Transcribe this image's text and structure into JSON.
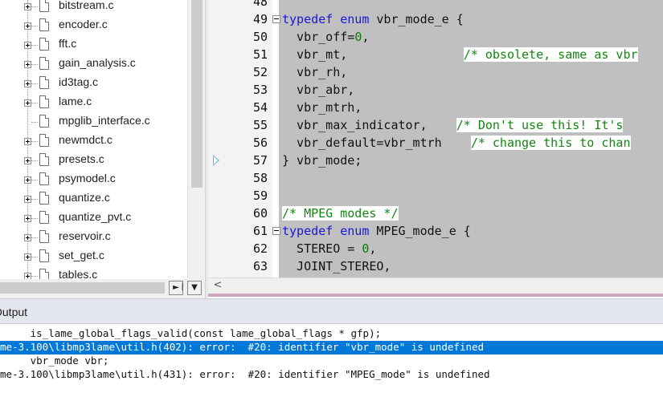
{
  "file_tree": {
    "items": [
      {
        "label": "bitstream.c",
        "expandable": true
      },
      {
        "label": "encoder.c",
        "expandable": true
      },
      {
        "label": "fft.c",
        "expandable": true
      },
      {
        "label": "gain_analysis.c",
        "expandable": true
      },
      {
        "label": "id3tag.c",
        "expandable": true
      },
      {
        "label": "lame.c",
        "expandable": true
      },
      {
        "label": "mpglib_interface.c",
        "expandable": false
      },
      {
        "label": "newmdct.c",
        "expandable": true
      },
      {
        "label": "presets.c",
        "expandable": true
      },
      {
        "label": "psymodel.c",
        "expandable": true
      },
      {
        "label": "quantize.c",
        "expandable": true
      },
      {
        "label": "quantize_pvt.c",
        "expandable": true
      },
      {
        "label": "reservoir.c",
        "expandable": true
      },
      {
        "label": "set_get.c",
        "expandable": true
      },
      {
        "label": "tables.c",
        "expandable": true
      }
    ],
    "scroll_right_arrow": "►",
    "scroll_split": "|",
    "scroll_down_arrow": "▼"
  },
  "editor": {
    "scroll_left_arrow": "<",
    "lines": [
      {
        "num": "48",
        "text": ""
      },
      {
        "num": "49",
        "text": "typedef enum vbr_mode_e {"
      },
      {
        "num": "50",
        "text": "  vbr_off=0,"
      },
      {
        "num": "51",
        "text": "  vbr_mt,                /* obsolete, same as vbr"
      },
      {
        "num": "52",
        "text": "  vbr_rh,"
      },
      {
        "num": "53",
        "text": "  vbr_abr,"
      },
      {
        "num": "54",
        "text": "  vbr_mtrh,"
      },
      {
        "num": "55",
        "text": "  vbr_max_indicator,    /* Don't use this! It's"
      },
      {
        "num": "56",
        "text": "  vbr_default=vbr_mtrh    /* change this to chan"
      },
      {
        "num": "57",
        "text": "} vbr_mode;"
      },
      {
        "num": "58",
        "text": ""
      },
      {
        "num": "59",
        "text": ""
      },
      {
        "num": "60",
        "text": "/* MPEG modes */"
      },
      {
        "num": "61",
        "text": "typedef enum MPEG_mode_e {"
      },
      {
        "num": "62",
        "text": "  STEREO = 0,"
      },
      {
        "num": "63",
        "text": "  JOINT_STEREO,"
      }
    ]
  },
  "output": {
    "title": "Output",
    "lines": [
      {
        "text": "     is_lame_global_flags_valid(const lame_global_flags * gfp);",
        "selected": false
      },
      {
        "text": "me-3.100\\libmp3lame\\util.h(402): error:  #20: identifier \"vbr_mode\" is undefined",
        "selected": true
      },
      {
        "text": "     vbr_mode vbr;",
        "selected": false
      },
      {
        "text": "me-3.100\\libmp3lame\\util.h(431): error:  #20: identifier \"MPEG_mode\" is undefined",
        "selected": false
      }
    ]
  },
  "colors": {
    "keyword": "#1a17d6",
    "number": "#0a7d0a",
    "comment": "#128512",
    "selection": "#0078d7"
  }
}
